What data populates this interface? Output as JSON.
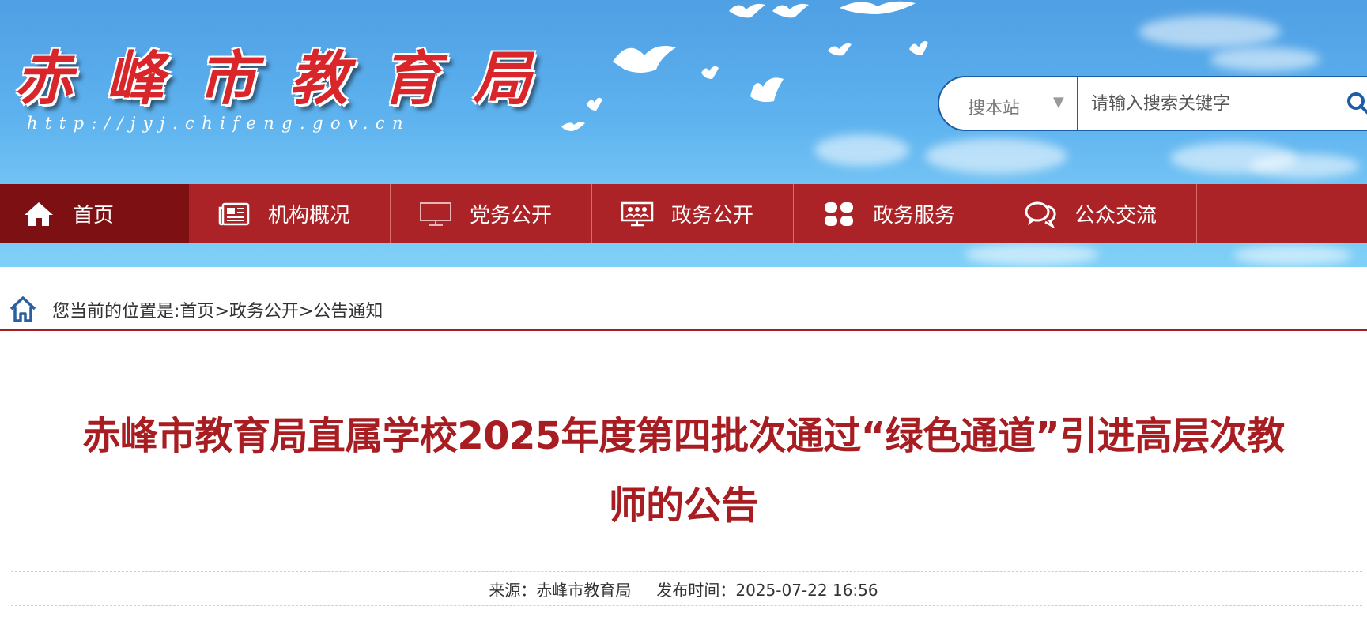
{
  "header": {
    "site_name": "赤峰市教育局",
    "site_url": "http://jyj.chifeng.gov.cn"
  },
  "search": {
    "scope": "搜本站",
    "scope_arrow": "▼",
    "placeholder": "请输入搜索关键字",
    "button_icon": "search-icon"
  },
  "nav": {
    "items": [
      {
        "label": "首页",
        "icon": "home-icon",
        "active": true
      },
      {
        "label": "机构概况",
        "icon": "newspaper-icon"
      },
      {
        "label": "党务公开",
        "icon": "monitor-icon"
      },
      {
        "label": "政务公开",
        "icon": "presentation-icon"
      },
      {
        "label": "政务服务",
        "icon": "grid-icon"
      },
      {
        "label": "公众交流",
        "icon": "chat-icon"
      }
    ]
  },
  "breadcrumb": {
    "prefix": "您当前的位置是:",
    "items": [
      "首页",
      "政务公开",
      "公告通知"
    ],
    "separator": ">"
  },
  "article": {
    "title_line1": "赤峰市教育局直属学校2025年度第四批次通过“绿色通道”引进高层次教",
    "title_line2": "师的公告",
    "source_label": "来源：",
    "source": "赤峰市教育局",
    "time_label": "发布时间：",
    "time": "2025-07-22 16:56"
  },
  "colors": {
    "nav_bg": "#ab2326",
    "nav_active": "#7d1013",
    "title_red": "#a71d22",
    "search_border": "#1d5ca6"
  }
}
